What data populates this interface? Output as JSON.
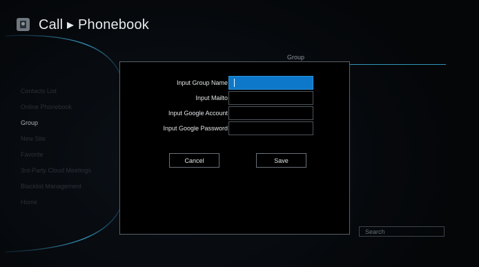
{
  "header": {
    "icon": "contacts-book-icon",
    "title": "Call ▸ Phonebook"
  },
  "group_panel": {
    "header": "Group"
  },
  "sidebar": {
    "items": [
      {
        "label": "Contacts List",
        "active": false
      },
      {
        "label": "Online Phonebook",
        "active": false
      },
      {
        "label": "Group",
        "active": true
      },
      {
        "label": "New Site",
        "active": false
      },
      {
        "label": "Favorite",
        "active": false
      },
      {
        "label": "3rd-Party Cloud Meetings",
        "active": false
      },
      {
        "label": "Blacklist Management",
        "active": false
      },
      {
        "label": "Home",
        "active": false
      }
    ]
  },
  "search": {
    "placeholder": "Search"
  },
  "dialog": {
    "fields": [
      {
        "label": "Input Group Name",
        "value": "",
        "focused": true
      },
      {
        "label": "Input Mailto",
        "value": "",
        "focused": false
      },
      {
        "label": "Input Google Account",
        "value": "",
        "focused": false
      },
      {
        "label": "Input Google Password",
        "value": "",
        "focused": false
      }
    ],
    "cancel_label": "Cancel",
    "save_label": "Save"
  },
  "colors": {
    "accent": "#0d78c9",
    "focus_border": "#2e94de",
    "divider": "#2f97b8"
  }
}
